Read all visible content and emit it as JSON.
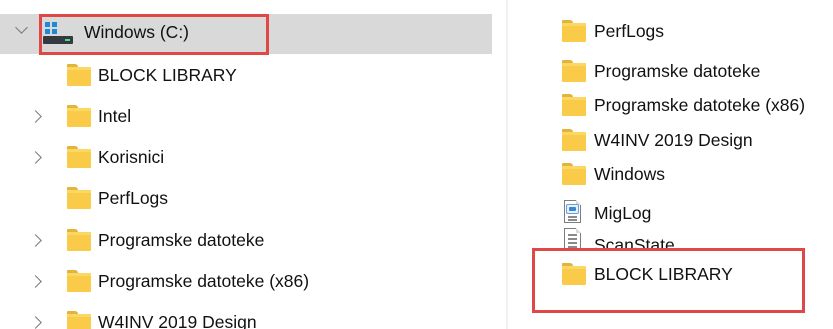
{
  "navigation_pane": {
    "drive": {
      "label": "Windows (C:)",
      "expanded": true,
      "icon": "drive-icon"
    },
    "items": [
      {
        "label": "BLOCK LIBRARY",
        "has_children": false,
        "icon": "folder-icon"
      },
      {
        "label": "Intel",
        "has_children": true,
        "icon": "folder-icon"
      },
      {
        "label": "Korisnici",
        "has_children": true,
        "icon": "folder-icon"
      },
      {
        "label": "PerfLogs",
        "has_children": false,
        "icon": "folder-icon"
      },
      {
        "label": "Programske datoteke",
        "has_children": true,
        "icon": "folder-icon"
      },
      {
        "label": "Programske datoteke (x86)",
        "has_children": true,
        "icon": "folder-icon"
      },
      {
        "label": "W4INV 2019 Design",
        "has_children": true,
        "icon": "folder-icon"
      }
    ]
  },
  "content_pane": {
    "items": [
      {
        "label": "PerfLogs",
        "type": "folder",
        "icon": "folder-icon"
      },
      {
        "label": "Programske datoteke",
        "type": "folder",
        "icon": "folder-icon"
      },
      {
        "label": "Programske datoteke (x86)",
        "type": "folder",
        "icon": "folder-icon"
      },
      {
        "label": "W4INV 2019 Design",
        "type": "folder",
        "icon": "folder-icon"
      },
      {
        "label": "Windows",
        "type": "folder",
        "icon": "folder-icon"
      },
      {
        "label": "MigLog",
        "type": "file",
        "icon": "log-file-icon"
      },
      {
        "label": "ScanState",
        "type": "file",
        "icon": "text-file-icon"
      },
      {
        "label": "BLOCK LIBRARY",
        "type": "folder",
        "icon": "folder-icon"
      }
    ]
  },
  "colors": {
    "highlight_box": "#e04848",
    "selected_row": "#d9d9d9",
    "folder": "#f9cb48"
  }
}
